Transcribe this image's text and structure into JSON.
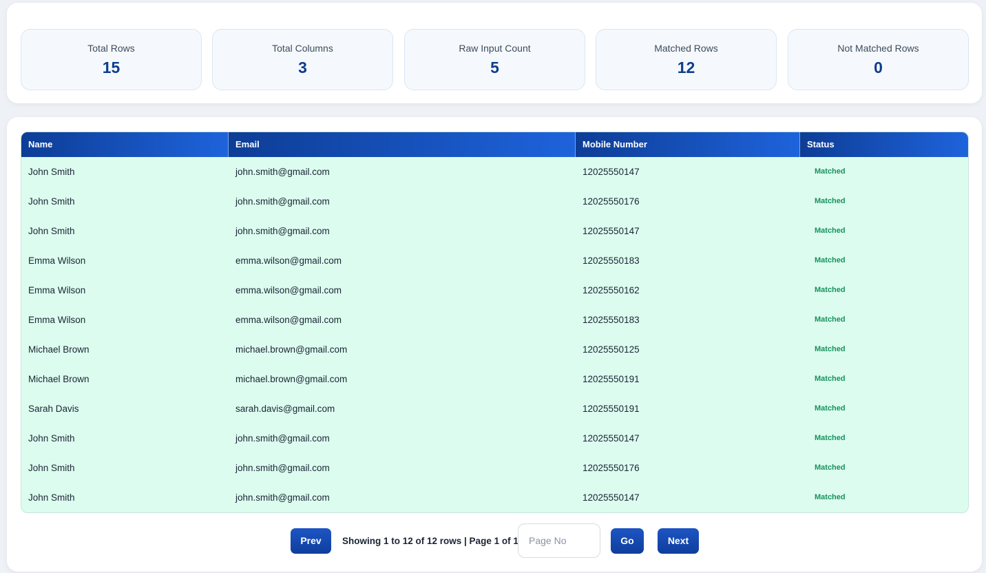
{
  "stats": [
    {
      "label": "Total Rows",
      "value": "15"
    },
    {
      "label": "Total Columns",
      "value": "3"
    },
    {
      "label": "Raw Input Count",
      "value": "5"
    },
    {
      "label": "Matched Rows",
      "value": "12"
    },
    {
      "label": "Not Matched Rows",
      "value": "0"
    }
  ],
  "table": {
    "headers": [
      "Name",
      "Email",
      "Mobile Number",
      "Status"
    ],
    "rows": [
      [
        "John Smith",
        "john.smith@gmail.com",
        "12025550147",
        "Matched"
      ],
      [
        "John Smith",
        "john.smith@gmail.com",
        "12025550176",
        "Matched"
      ],
      [
        "John Smith",
        "john.smith@gmail.com",
        "12025550147",
        "Matched"
      ],
      [
        "Emma Wilson",
        "emma.wilson@gmail.com",
        "12025550183",
        "Matched"
      ],
      [
        "Emma Wilson",
        "emma.wilson@gmail.com",
        "12025550162",
        "Matched"
      ],
      [
        "Emma Wilson",
        "emma.wilson@gmail.com",
        "12025550183",
        "Matched"
      ],
      [
        "Michael Brown",
        "michael.brown@gmail.com",
        "12025550125",
        "Matched"
      ],
      [
        "Michael Brown",
        "michael.brown@gmail.com",
        "12025550191",
        "Matched"
      ],
      [
        "Sarah Davis",
        "sarah.davis@gmail.com",
        "12025550191",
        "Matched"
      ],
      [
        "John Smith",
        "john.smith@gmail.com",
        "12025550147",
        "Matched"
      ],
      [
        "John Smith",
        "john.smith@gmail.com",
        "12025550176",
        "Matched"
      ],
      [
        "John Smith",
        "john.smith@gmail.com",
        "12025550147",
        "Matched"
      ]
    ]
  },
  "pagination": {
    "prev_label": "Prev",
    "info": "Showing 1 to 12 of 12 rows | Page 1 of 1",
    "page_input_value": "",
    "page_input_placeholder": "Page No",
    "go_label": "Go",
    "next_label": "Next"
  },
  "colors": {
    "header_gradient_start": "#0d3d96",
    "header_gradient_end": "#1e63dc",
    "matched_row_bg": "#dcfcef",
    "matched_status_text": "#16925c",
    "stat_value_text": "#0e3d8a"
  }
}
